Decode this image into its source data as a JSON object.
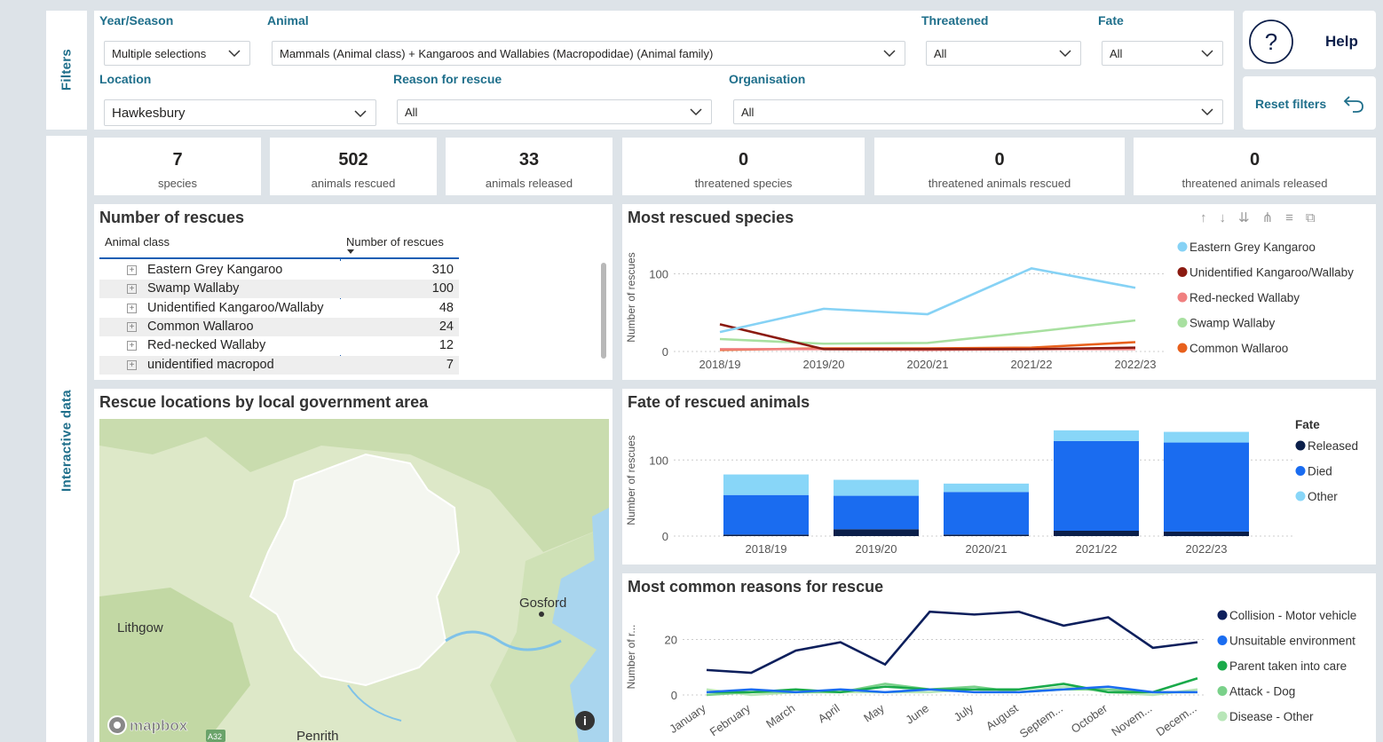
{
  "sections": {
    "filters": "Filters",
    "interactive": "Interactive data"
  },
  "filters": {
    "year_label": "Year/Season",
    "year_value": "Multiple selections",
    "animal_label": "Animal",
    "animal_value": "Mammals (Animal class) + Kangaroos and Wallabies (Macropodidae) (Animal family)",
    "threatened_label": "Threatened",
    "threatened_value": "All",
    "fate_label": "Fate",
    "fate_value": "All",
    "location_label": "Location",
    "location_value": "Hawkesbury",
    "reason_label": "Reason for rescue",
    "reason_value": "All",
    "org_label": "Organisation",
    "org_value": "All"
  },
  "actions": {
    "help": "Help",
    "reset": "Reset filters"
  },
  "kpis": [
    {
      "value": "7",
      "label": "species"
    },
    {
      "value": "502",
      "label": "animals rescued"
    },
    {
      "value": "33",
      "label": "animals released"
    },
    {
      "value": "0",
      "label": "threatened species"
    },
    {
      "value": "0",
      "label": "threatened animals rescued"
    },
    {
      "value": "0",
      "label": "threatened animals released"
    }
  ],
  "rescues_table": {
    "title": "Number of rescues",
    "col1": "Animal class",
    "col2": "Number of rescues",
    "rows": [
      {
        "name": "Eastern Grey Kangaroo",
        "value": "310"
      },
      {
        "name": "Swamp Wallaby",
        "value": "100"
      },
      {
        "name": "Unidentified Kangaroo/Wallaby",
        "value": "48"
      },
      {
        "name": "Common Wallaroo",
        "value": "24"
      },
      {
        "name": "Red-necked Wallaby",
        "value": "12"
      },
      {
        "name": "unidentified macropod",
        "value": "7"
      }
    ]
  },
  "map": {
    "title": "Rescue locations by local government area",
    "labels": [
      "Gosford",
      "Lithgow",
      "Penrith"
    ],
    "logo": "mapbox",
    "road": "A32"
  },
  "colors": {
    "accent": "#1f6f8b",
    "panel": "#ffffff",
    "bg": "#dde3e8"
  },
  "chart_data": [
    {
      "type": "line",
      "title": "Most rescued species",
      "ylabel": "Number of rescues",
      "x": [
        "2018/19",
        "2019/20",
        "2020/21",
        "2021/22",
        "2022/23"
      ],
      "ylim": [
        0,
        120
      ],
      "yticks": [
        0,
        100
      ],
      "series": [
        {
          "name": "Eastern Grey Kangaroo",
          "color": "#86d2f5",
          "values": [
            25,
            55,
            48,
            107,
            82
          ]
        },
        {
          "name": "Unidentified Kangaroo/Wallaby",
          "color": "#8b1a10",
          "values": [
            35,
            3,
            3,
            3,
            5
          ]
        },
        {
          "name": "Red-necked Wallaby",
          "color": "#f08080",
          "values": [
            3,
            3,
            2,
            3,
            3
          ]
        },
        {
          "name": "Swamp Wallaby",
          "color": "#a8e0a0",
          "values": [
            16,
            10,
            11,
            25,
            40
          ]
        },
        {
          "name": "Common Wallaroo",
          "color": "#e8601c",
          "values": [
            2,
            4,
            4,
            5,
            12
          ]
        }
      ]
    },
    {
      "type": "bar",
      "title": "Fate of rescued animals",
      "ylabel": "Number of rescues",
      "legend_title": "Fate",
      "categories": [
        "2018/19",
        "2019/20",
        "2020/21",
        "2021/22",
        "2022/23"
      ],
      "ylim": [
        0,
        140
      ],
      "yticks": [
        0,
        100
      ],
      "stacked": true,
      "series": [
        {
          "name": "Released",
          "color": "#0b1f4a",
          "values": [
            2,
            9,
            2,
            7,
            6
          ]
        },
        {
          "name": "Died",
          "color": "#1a6cf0",
          "values": [
            52,
            44,
            56,
            118,
            117
          ]
        },
        {
          "name": "Other",
          "color": "#88d6f8",
          "values": [
            27,
            21,
            11,
            14,
            14
          ]
        }
      ]
    },
    {
      "type": "line",
      "title": "Most common reasons for rescue",
      "ylabel": "Number of r...",
      "x": [
        "January",
        "February",
        "March",
        "April",
        "May",
        "June",
        "July",
        "August",
        "Septem...",
        "October",
        "Novem...",
        "Decem..."
      ],
      "ylim": [
        0,
        32
      ],
      "yticks": [
        0,
        20
      ],
      "series": [
        {
          "name": "Collision - Motor vehicle",
          "color": "#0d1f5c",
          "values": [
            9,
            8,
            16,
            19,
            11,
            30,
            29,
            30,
            25,
            28,
            17,
            19
          ]
        },
        {
          "name": "Unsuitable environment",
          "color": "#1a6cf0",
          "values": [
            1,
            2,
            1,
            2,
            1,
            2,
            1,
            1,
            2,
            3,
            1,
            1
          ]
        },
        {
          "name": "Parent taken into care",
          "color": "#1aaa4a",
          "values": [
            1,
            1,
            2,
            1,
            3,
            2,
            2,
            2,
            4,
            1,
            1,
            6
          ]
        },
        {
          "name": "Attack - Dog",
          "color": "#7ad18a",
          "values": [
            0,
            1,
            1,
            1,
            4,
            2,
            3,
            1,
            2,
            2,
            1,
            1
          ]
        },
        {
          "name": "Disease - Other",
          "color": "#b8e6b8",
          "values": [
            2,
            0,
            1,
            1,
            1,
            1,
            2,
            1,
            3,
            1,
            0,
            2
          ]
        }
      ]
    }
  ]
}
